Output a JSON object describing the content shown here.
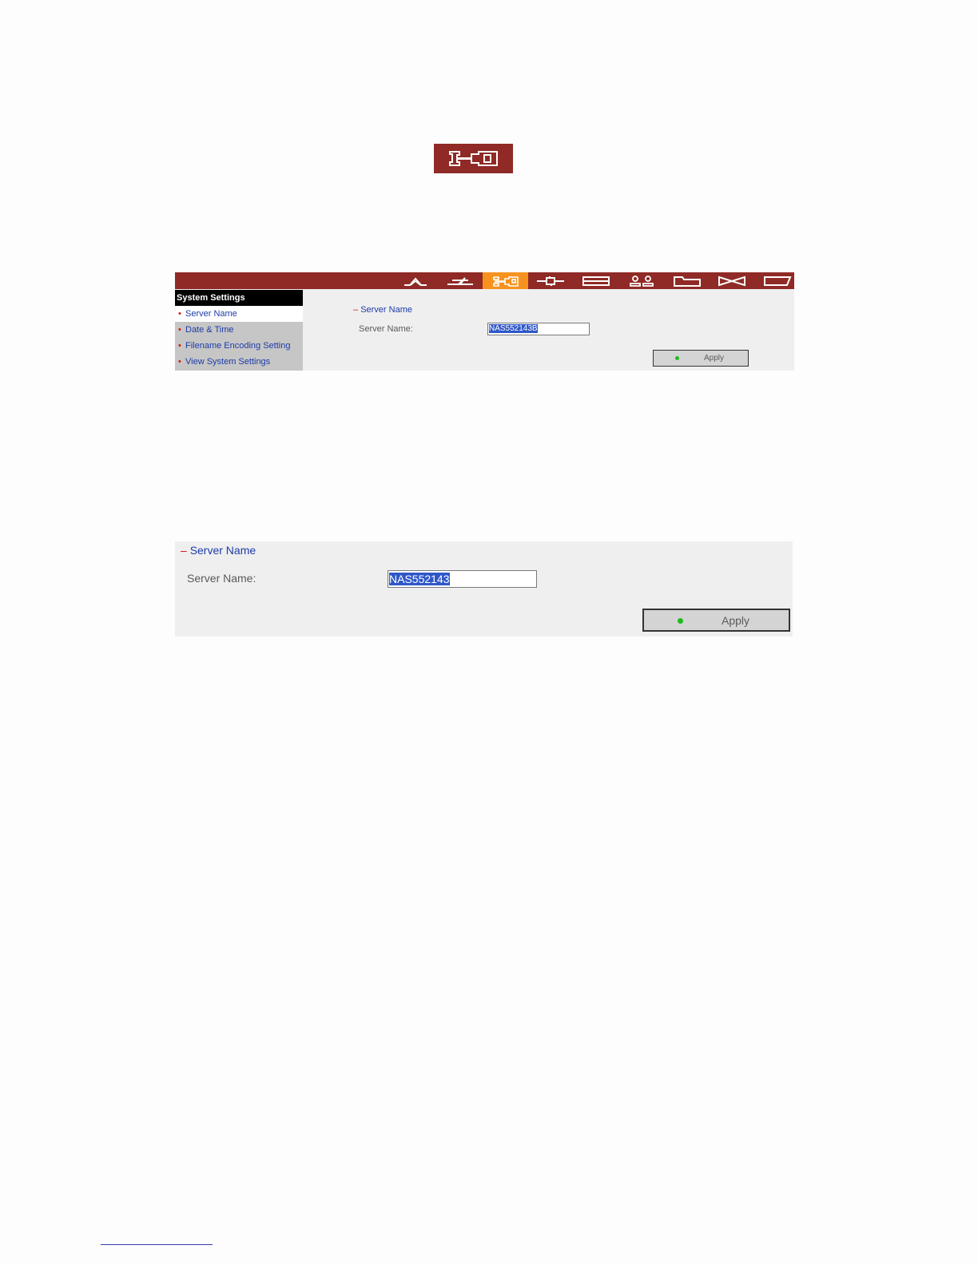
{
  "system_icon": "system-settings-icon",
  "nav_icons": [
    {
      "name": "home-icon",
      "active": false
    },
    {
      "name": "quick-config-icon",
      "active": false
    },
    {
      "name": "system-settings-icon",
      "active": true
    },
    {
      "name": "network-icon",
      "active": false
    },
    {
      "name": "device-icon",
      "active": false
    },
    {
      "name": "users-icon",
      "active": false
    },
    {
      "name": "folder-icon",
      "active": false
    },
    {
      "name": "tools-icon",
      "active": false
    },
    {
      "name": "status-icon",
      "active": false
    }
  ],
  "colors": {
    "bar": "#8f2a26",
    "active_tab": "#f7921e",
    "link": "#1d3ba8",
    "bullet": "#dd1111",
    "indicator": "#1fba1f"
  },
  "sidebar": {
    "title": "System Settings",
    "items": [
      {
        "label": "Server Name",
        "selected": true
      },
      {
        "label": "Date & Time",
        "selected": false
      },
      {
        "label": "Filename Encoding Setting",
        "selected": false
      },
      {
        "label": "View System Settings",
        "selected": false
      }
    ]
  },
  "panel": {
    "section_dash": "–",
    "section_title": "Server Name",
    "field_label": "Server Name:",
    "field_value_small": "NAS552143B",
    "field_value_large": "NAS552143",
    "apply_label": "Apply"
  }
}
